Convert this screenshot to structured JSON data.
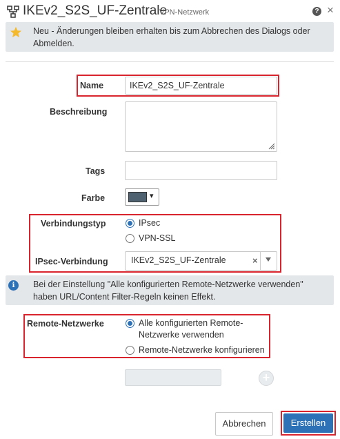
{
  "header": {
    "title": "IKEv2_S2S_UF-Zentrale",
    "subtitle": "VPN-Netzwerk",
    "help_glyph": "?",
    "close_glyph": "×",
    "icon": "network-icon"
  },
  "notice_new": {
    "icon": "star-icon",
    "text": "Neu - Änderungen bleiben erhalten bis zum Abbrechen des Dialogs oder Abmelden."
  },
  "form": {
    "name": {
      "label": "Name",
      "value": "IKEv2_S2S_UF-Zentrale"
    },
    "description": {
      "label": "Beschreibung",
      "value": ""
    },
    "tags": {
      "label": "Tags",
      "value": ""
    },
    "color": {
      "label": "Farbe",
      "value": "#4e6272",
      "caret": "▾"
    },
    "connection_type": {
      "label": "Verbindungstyp",
      "options": [
        "IPsec",
        "VPN-SSL"
      ],
      "selected": "IPsec"
    },
    "ipsec_connection": {
      "label": "IPsec-Verbindung",
      "value": "IKEv2_S2S_UF-Zentrale",
      "clear_glyph": "×"
    }
  },
  "notice_info": {
    "icon_glyph": "i",
    "text": "Bei der Einstellung \"Alle konfigurierten Remote-Netzwerke verwenden\" haben URL/Content Filter-Regeln keinen Effekt."
  },
  "remote": {
    "label": "Remote-Netzwerke",
    "options": [
      "Alle konfigurierten Remote-Netzwerke verwenden",
      "Remote-Netzwerke konfigurieren"
    ],
    "selected": "Alle konfigurierten Remote-Netzwerke verwenden",
    "add_glyph": "+"
  },
  "buttons": {
    "cancel": "Abbrechen",
    "create": "Erstellen"
  },
  "colors": {
    "accent": "#2d72b7",
    "highlight": "#d9232d",
    "notice_bg": "#e4e7ea"
  }
}
